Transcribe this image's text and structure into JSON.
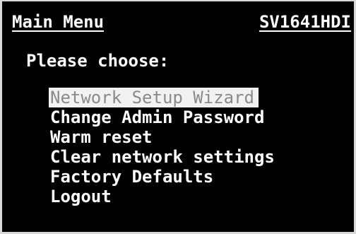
{
  "header": {
    "title": "Main Menu",
    "model": "SV1641HDI"
  },
  "prompt": "Please choose:",
  "menu": {
    "selected_index": 0,
    "items": [
      {
        "label": "Network Setup Wizard"
      },
      {
        "label": "Change Admin Password"
      },
      {
        "label": "Warm reset"
      },
      {
        "label": "Clear network settings"
      },
      {
        "label": "Factory Defaults"
      },
      {
        "label": "Logout"
      }
    ]
  },
  "colors": {
    "background": "#000000",
    "text": "#ffffff",
    "highlight_bg": "#f2f2f2",
    "highlight_text": "#8a8a8a",
    "frame": "#d9d9d9"
  }
}
